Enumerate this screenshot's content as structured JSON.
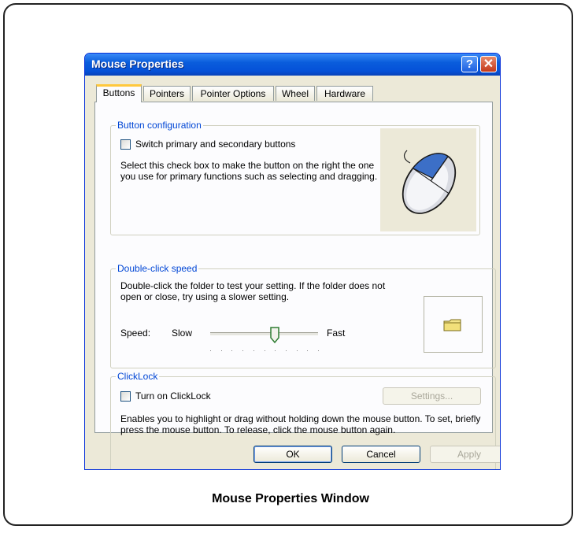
{
  "window": {
    "title": "Mouse Properties",
    "help_glyph": "?",
    "close_glyph": "✕"
  },
  "tabs": [
    {
      "label": "Buttons",
      "active": true
    },
    {
      "label": "Pointers",
      "active": false
    },
    {
      "label": "Pointer Options",
      "active": false
    },
    {
      "label": "Wheel",
      "active": false
    },
    {
      "label": "Hardware",
      "active": false
    }
  ],
  "button_config": {
    "legend": "Button configuration",
    "checkbox_label": "Switch primary and secondary buttons",
    "checked": false,
    "description": "Select this check box to make the button on the right the one you use for primary functions such as selecting and dragging."
  },
  "double_click": {
    "legend": "Double-click speed",
    "description": "Double-click the folder to test your setting. If the folder does not open or close, try using a slower setting.",
    "speed_label": "Speed:",
    "slow_label": "Slow",
    "fast_label": "Fast",
    "speed_value": 0.6
  },
  "clicklock": {
    "legend": "ClickLock",
    "checkbox_label": "Turn on ClickLock",
    "checked": false,
    "settings_label": "Settings...",
    "description": "Enables you to highlight or drag without holding down the mouse button. To set, briefly press the mouse button. To release, click the mouse button again."
  },
  "footer": {
    "ok_label": "OK",
    "cancel_label": "Cancel",
    "apply_label": "Apply"
  },
  "caption": "Mouse Properties Window"
}
